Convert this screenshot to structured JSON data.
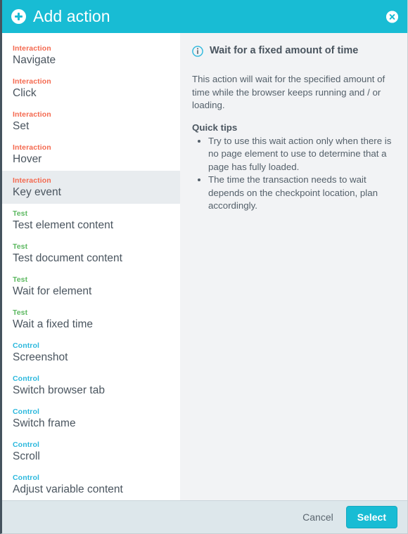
{
  "header": {
    "title": "Add action",
    "add_icon": "plus-circle-icon",
    "close_icon": "close-circle-icon",
    "background_color": "#18bcd4"
  },
  "actions": [
    {
      "category": "Interaction",
      "label": "Navigate",
      "selected": false
    },
    {
      "category": "Interaction",
      "label": "Click",
      "selected": false
    },
    {
      "category": "Interaction",
      "label": "Set",
      "selected": false
    },
    {
      "category": "Interaction",
      "label": "Hover",
      "selected": false
    },
    {
      "category": "Interaction",
      "label": "Key event",
      "selected": true
    },
    {
      "category": "Test",
      "label": "Test element content",
      "selected": false
    },
    {
      "category": "Test",
      "label": "Test document content",
      "selected": false
    },
    {
      "category": "Test",
      "label": "Wait for element",
      "selected": false
    },
    {
      "category": "Test",
      "label": "Wait a fixed time",
      "selected": false
    },
    {
      "category": "Control",
      "label": "Screenshot",
      "selected": false
    },
    {
      "category": "Control",
      "label": "Switch browser tab",
      "selected": false
    },
    {
      "category": "Control",
      "label": "Switch frame",
      "selected": false
    },
    {
      "category": "Control",
      "label": "Scroll",
      "selected": false
    },
    {
      "category": "Control",
      "label": "Adjust variable content",
      "selected": false
    }
  ],
  "category_colors": {
    "Interaction": "#f4694f",
    "Test": "#5cb860",
    "Control": "#2bb8dd"
  },
  "detail": {
    "info_icon": "info-circle-icon",
    "title": "Wait for a fixed amount of time",
    "description": "This action will wait for the specified amount of time while the browser keeps running and / or loading.",
    "tips_title": "Quick tips",
    "tips": [
      "Try to use this wait action only when there is no page element to use to determine that a page has fully loaded.",
      "The time the transaction needs to wait depends on the checkpoint location, plan accordingly."
    ]
  },
  "footer": {
    "cancel_label": "Cancel",
    "select_label": "Select",
    "select_color": "#18bcd4"
  }
}
